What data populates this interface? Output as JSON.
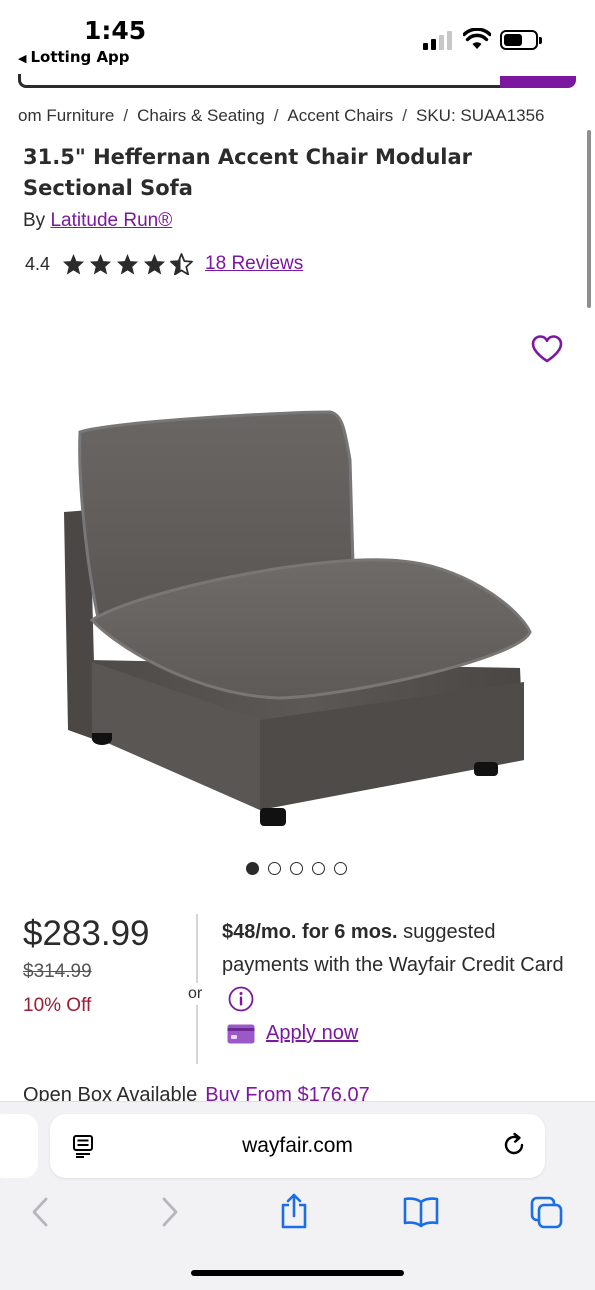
{
  "status_bar": {
    "time": "1:45",
    "back_app": "Lotting App"
  },
  "breadcrumb": [
    "om Furniture",
    "Chairs & Seating",
    "Accent Chairs",
    "SKU: SUAA1356"
  ],
  "product": {
    "title": "31.5\" Heffernan Accent Chair Modular Sectional Sofa",
    "by_prefix": "By",
    "brand": "Latitude Run®",
    "rating": "4.4",
    "rating_value": 4.4,
    "rating_max": 5,
    "reviews_link": "18 Reviews",
    "image_count": 5,
    "active_image_index": 0
  },
  "pricing": {
    "price": "$283.99",
    "old_price": "$314.99",
    "discount": "10% Off",
    "or": "or",
    "financing_bold": "$48/mo. for 6 mos.",
    "financing_rest": " suggested payments with the Wayfair Credit Card",
    "apply_now": "Apply now"
  },
  "open_box": {
    "label": "Open Box Available",
    "link": "Buy From $176.07"
  },
  "browser": {
    "domain": "wayfair.com"
  },
  "colors": {
    "brand_purple": "#7b189f",
    "discount_red": "#9e1b32",
    "text": "#2b2b2b"
  },
  "icons": {
    "heart": "heart-outline-icon",
    "info": "info-circle-icon",
    "card": "credit-card-icon",
    "reader": "reader-view-icon",
    "reload": "reload-icon",
    "back": "back-chevron-icon",
    "forward": "forward-chevron-icon",
    "share": "share-icon",
    "bookmarks": "bookmarks-icon",
    "tabs": "tabs-icon"
  }
}
